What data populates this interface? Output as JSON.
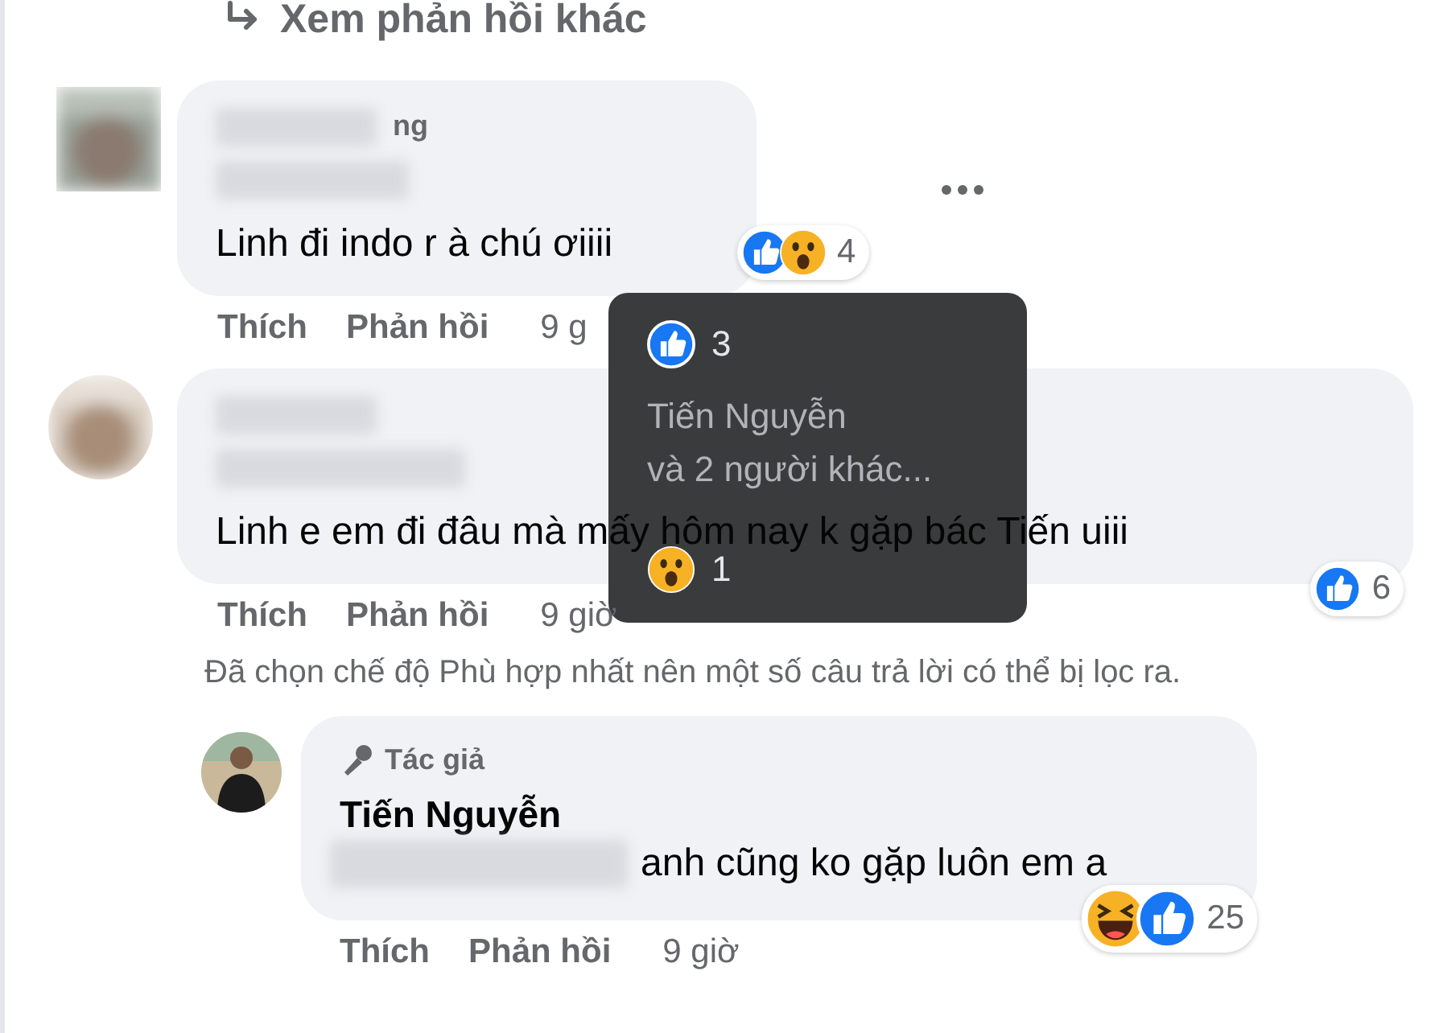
{
  "more_replies_link": {
    "label": "Xem phản hồi khác"
  },
  "comments": [
    {
      "author_visible": "ng",
      "text": "Linh đi indo r à chú ơiiii",
      "reactions": [
        {
          "kind": "like"
        },
        {
          "kind": "wow"
        }
      ],
      "reaction_count": "4",
      "actions": [
        "Thích",
        "Phản hồi"
      ],
      "time": "9 g",
      "more_button": true
    },
    {
      "text": "Linh e em đi đâu mà mấy hôm nay k gặp bác Tiến uiii",
      "reactions": [
        {
          "kind": "like"
        }
      ],
      "reaction_count": "6",
      "actions": [
        "Thích",
        "Phản hồi"
      ],
      "time": "9 giờ",
      "more_button": false
    }
  ],
  "filter_notice": "Đã chọn chế độ Phù hợp nhất nên một số câu trả lời có thể bị lọc ra.",
  "reply": {
    "badge": "Tác giả",
    "author": "Tiến Nguyễn",
    "text": "anh cũng ko gặp luôn em a",
    "reactions": [
      {
        "kind": "haha"
      },
      {
        "kind": "like"
      }
    ],
    "reaction_count": "25",
    "actions": [
      "Thích",
      "Phản hồi"
    ],
    "time": "9 giờ"
  },
  "tooltip": {
    "rows": [
      {
        "kind": "reaction",
        "reaction": {
          "kind": "like"
        },
        "count": "3"
      },
      {
        "kind": "names",
        "lines": [
          "Tiến Nguyễn",
          "và 2 người khác..."
        ]
      },
      {
        "kind": "reaction",
        "reaction": {
          "kind": "wow"
        },
        "count": "1"
      }
    ]
  }
}
